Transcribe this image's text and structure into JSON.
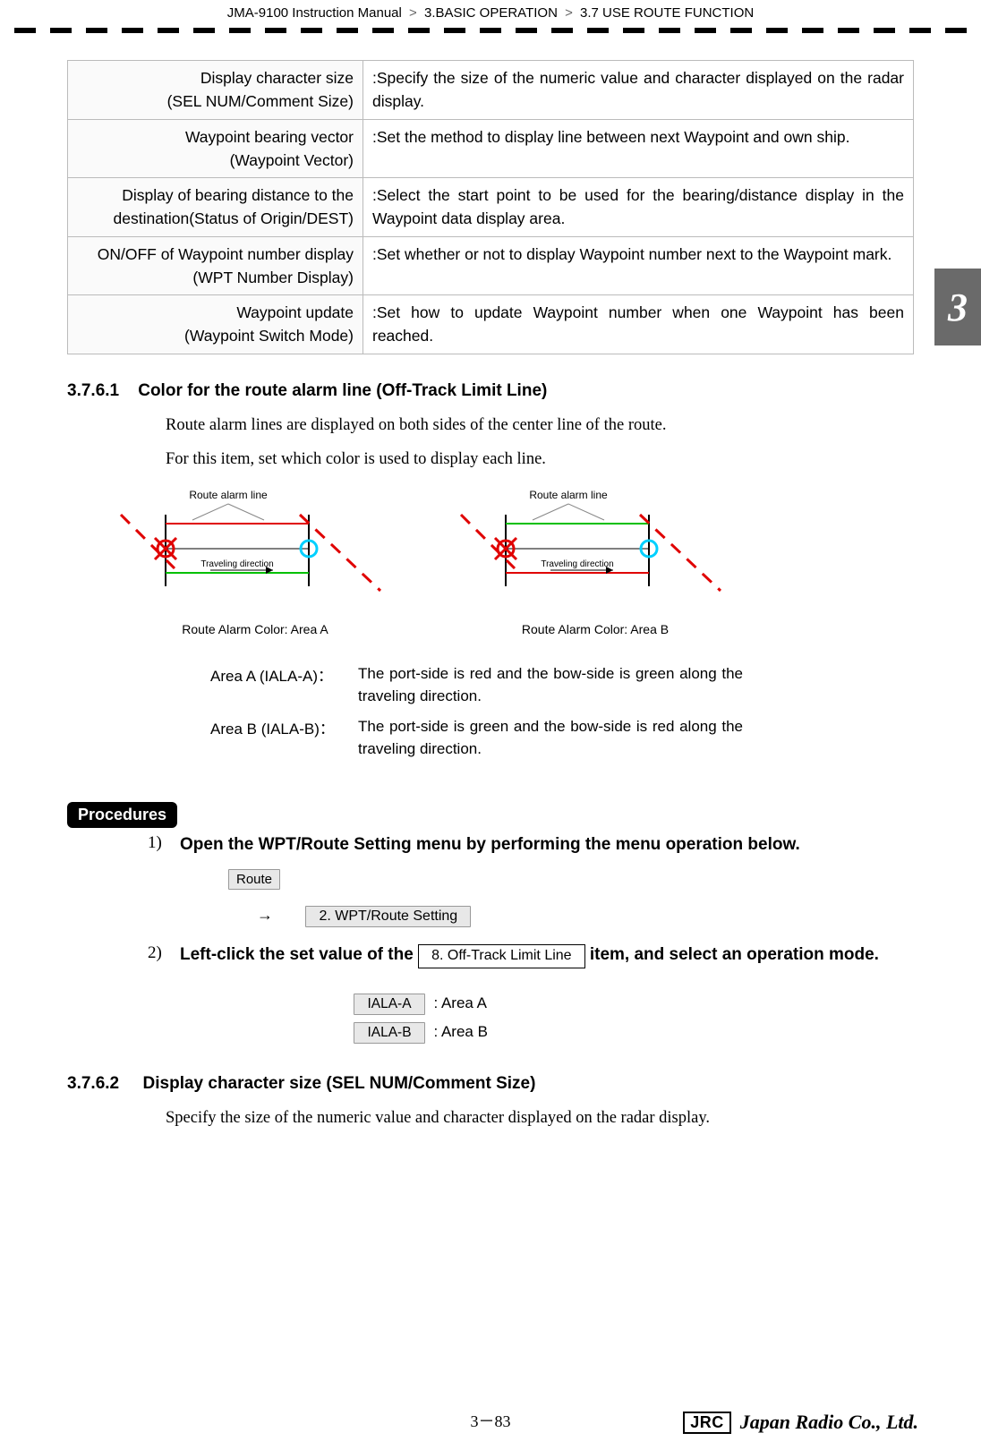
{
  "header": {
    "manual": "JMA-9100 Instruction Manual",
    "chapter": "3.BASIC OPERATION",
    "section": "3.7  USE ROUTE FUNCTION"
  },
  "settings_table": [
    {
      "name_l1": "Display character size",
      "name_l2": "(SEL NUM/Comment Size)",
      "desc": ":Specify the size of the numeric value and character displayed on the radar display."
    },
    {
      "name_l1": "Waypoint bearing vector",
      "name_l2": "(Waypoint Vector)",
      "desc": ":Set the method to display line between next Waypoint and own ship."
    },
    {
      "name_l1": "Display of bearing distance to the",
      "name_l2": "destination(Status of Origin/DEST)",
      "desc": ":Select the start point to be used for the bearing/distance display in the Waypoint data display area."
    },
    {
      "name_l1": "ON/OFF of Waypoint number display",
      "name_l2": "(WPT Number Display)",
      "desc": ":Set whether or not to display Waypoint number next to the Waypoint mark."
    },
    {
      "name_l1": "Waypoint update",
      "name_l2": "(Waypoint Switch Mode)",
      "desc": ":Set how to update Waypoint number when one Waypoint has been reached."
    }
  ],
  "sec_37_6_1": {
    "num": "3.7.6.1",
    "title": "Color for the route alarm line (Off-Track Limit Line)",
    "p1": "Route alarm lines are displayed on both sides of the center line of the route.",
    "p2": "For this item, set which color is used to display each line.",
    "dg_top_label": "Route alarm line",
    "travel_dir": "Traveling direction",
    "dg_a_caption": "Route Alarm Color: Area A",
    "dg_b_caption": "Route Alarm Color: Area B",
    "area_a_label": "Area A (IALA-A)：",
    "area_a_desc": "The port-side is red and the bow-side is green along the traveling direction.",
    "area_b_label": "Area B (IALA-B)：",
    "area_b_desc": "The port-side is green and the bow-side is red along the traveling direction."
  },
  "procedures": {
    "badge": "Procedures",
    "step1_num": "1)",
    "step1_text": "Open the WPT/Route Setting menu by performing the menu operation below.",
    "btn_route": "Route",
    "btn_wptroute": "2. WPT/Route Setting",
    "step2_num": "2)",
    "step2_pre": "Left-click the set value of the ",
    "btn_offtrack": "8. Off-Track Limit Line",
    "step2_post": " item, and select an operation mode.",
    "choice_a_btn": "IALA-A",
    "choice_a_txt": ": Area A",
    "choice_b_btn": "IALA-B",
    "choice_b_txt": ": Area B"
  },
  "sec_37_6_2": {
    "num": "3.7.6.2",
    "title": "Display character size (SEL NUM/Comment Size)",
    "p1": "Specify the size of the numeric value and character displayed on the radar display."
  },
  "chapter_tab": "3",
  "page_num": "3－83",
  "footer_logo_box": "JRC",
  "footer_logo_txt": "Japan Radio Co., Ltd."
}
